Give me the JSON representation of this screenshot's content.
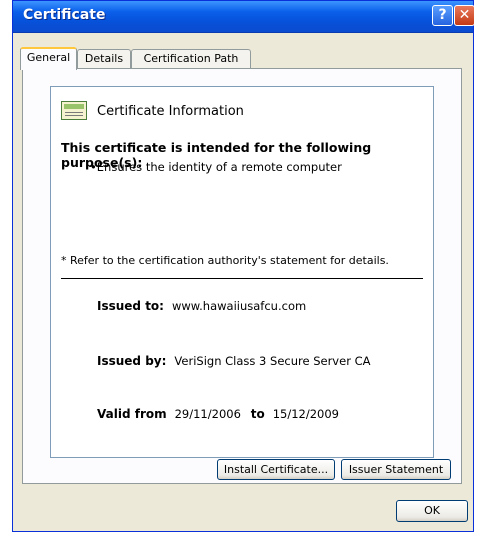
{
  "window": {
    "title": "Certificate",
    "help_glyph": "?",
    "close_glyph": "✕"
  },
  "tabs": [
    {
      "label": "General"
    },
    {
      "label": "Details"
    },
    {
      "label": "Certification Path"
    }
  ],
  "info": {
    "heading": "Certificate Information",
    "purpose_title": "This certificate is intended for the following purpose(s):",
    "purpose_item": "•Ensures the identity of a remote computer",
    "refer_note": "* Refer to the certification authority's statement for details.",
    "issued_to_label": "Issued to:",
    "issued_to_value": "www.hawaiiusafcu.com",
    "issued_by_label": "Issued by:",
    "issued_by_value": "VeriSign Class 3 Secure Server CA",
    "valid_from_label": "Valid from",
    "valid_from_value": "29/11/2006",
    "valid_to_label": "to",
    "valid_to_value": "15/12/2009"
  },
  "buttons": {
    "install": "Install Certificate...",
    "issuer": "Issuer Statement",
    "ok": "OK"
  },
  "icons": {
    "certificate": "certificate-icon",
    "help": "help-icon",
    "close": "close-icon"
  },
  "colors": {
    "titlebar": "#0a5fea",
    "tab_highlight": "#ffc83c",
    "dialog_bg": "#ece9d8"
  }
}
